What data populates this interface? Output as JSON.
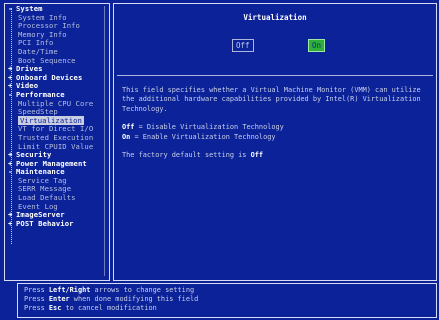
{
  "tree": {
    "items": [
      {
        "label": "System",
        "kind": "cat",
        "sign": "-"
      },
      {
        "label": "System Info",
        "kind": "child"
      },
      {
        "label": "Processor Info",
        "kind": "child"
      },
      {
        "label": "Memory Info",
        "kind": "child"
      },
      {
        "label": "PCI Info",
        "kind": "child"
      },
      {
        "label": "Date/Time",
        "kind": "child"
      },
      {
        "label": "Boot Sequence",
        "kind": "child"
      },
      {
        "label": "Drives",
        "kind": "cat",
        "sign": "+"
      },
      {
        "label": "Onboard Devices",
        "kind": "cat",
        "sign": "+"
      },
      {
        "label": "Video",
        "kind": "cat",
        "sign": "+"
      },
      {
        "label": "Performance",
        "kind": "cat",
        "sign": "-"
      },
      {
        "label": "Multiple CPU Core",
        "kind": "child"
      },
      {
        "label": "SpeedStep",
        "kind": "child"
      },
      {
        "label": "Virtualization",
        "kind": "child",
        "selected": true
      },
      {
        "label": "VT for Direct I/O",
        "kind": "child"
      },
      {
        "label": "Trusted Execution",
        "kind": "child"
      },
      {
        "label": "Limit CPUID Value",
        "kind": "child"
      },
      {
        "label": "Security",
        "kind": "cat",
        "sign": "+"
      },
      {
        "label": "Power Management",
        "kind": "cat",
        "sign": "+"
      },
      {
        "label": "Maintenance",
        "kind": "cat",
        "sign": "-"
      },
      {
        "label": "Service Tag",
        "kind": "child"
      },
      {
        "label": "SERR Message",
        "kind": "child"
      },
      {
        "label": "Load Defaults",
        "kind": "child"
      },
      {
        "label": "Event Log",
        "kind": "child"
      },
      {
        "label": "ImageServer",
        "kind": "cat",
        "sign": "+"
      },
      {
        "label": "POST Behavior",
        "kind": "cat",
        "sign": "+"
      }
    ]
  },
  "panel": {
    "title": "Virtualization",
    "option_off": "Off",
    "option_on": "On",
    "selected_option": "On",
    "description": "This field specifies whether a Virtual Machine Monitor (VMM) can utilize the additional hardware capabilities provided by Intel(R) Virtualization Technology.",
    "off_key": "Off",
    "off_text": "= Disable Virtualization Technology",
    "on_key": "On",
    "on_text": " = Enable Virtualization Technology",
    "default_prefix": "The factory default setting is ",
    "default_value": "Off"
  },
  "footer": {
    "line1_press": "Press ",
    "line1_key": "Left/Right",
    "line1_rest": " arrows to change setting",
    "line2_press": "Press ",
    "line2_key": "Enter",
    "line2_rest": " when done modifying this field",
    "line3_press": "Press ",
    "line3_key": "Esc",
    "line3_rest": " to cancel modification"
  },
  "colors": {
    "background": "#0b2299",
    "border": "#d8dcf0",
    "selected_on": "#2fae3a",
    "text": "#c8cfe8"
  }
}
